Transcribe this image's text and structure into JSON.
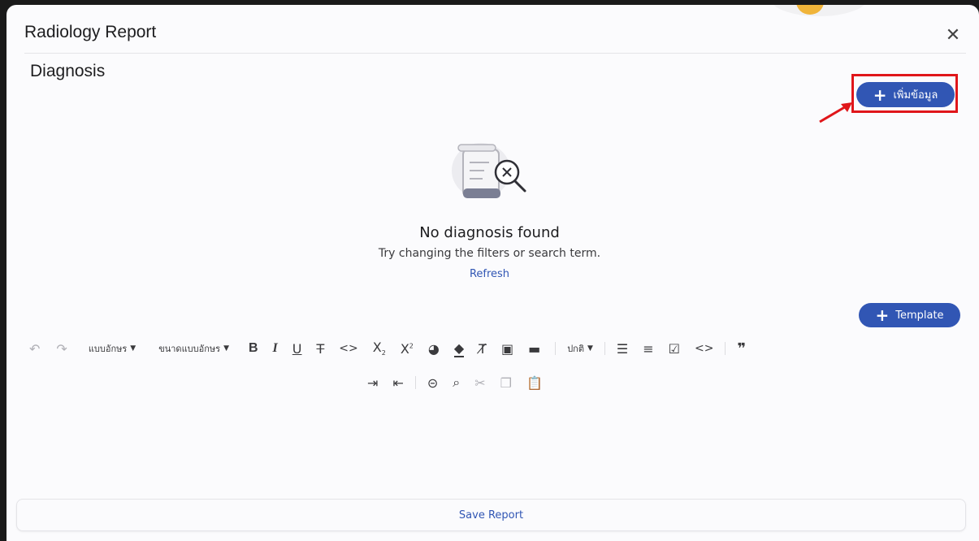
{
  "header": {
    "title": "Radiology Report",
    "close_icon": "close-icon"
  },
  "section": {
    "title": "Diagnosis"
  },
  "add_button": {
    "label": "เพิ่มข้อมูล",
    "icon": "plus-icon"
  },
  "empty_state": {
    "illustration": "document-search-icon",
    "title": "No diagnosis found",
    "subtitle": "Try changing the filters or search term.",
    "refresh_label": "Refresh"
  },
  "template_button": {
    "label": "Template",
    "icon": "plus-icon"
  },
  "toolbar": {
    "font_family_label": "แบบอักษร",
    "font_size_label": "ขนาดแบบอักษร",
    "paragraph_label": "ปกติ",
    "tools": [
      "undo",
      "redo",
      "bold",
      "italic",
      "underline",
      "strikethrough",
      "code",
      "subscript",
      "superscript",
      "text-color",
      "fill-color",
      "clear-format",
      "image",
      "video",
      "ordered-list",
      "unordered-list",
      "checklist",
      "code-block",
      "blockquote",
      "indent",
      "outdent",
      "link",
      "search",
      "cut",
      "copy",
      "paste"
    ]
  },
  "footer": {
    "save_label": "Save Report"
  },
  "colors": {
    "primary": "#3156b4",
    "highlight": "#e0161a",
    "text": "#1d1d1f",
    "background": "#fbfbfd"
  }
}
